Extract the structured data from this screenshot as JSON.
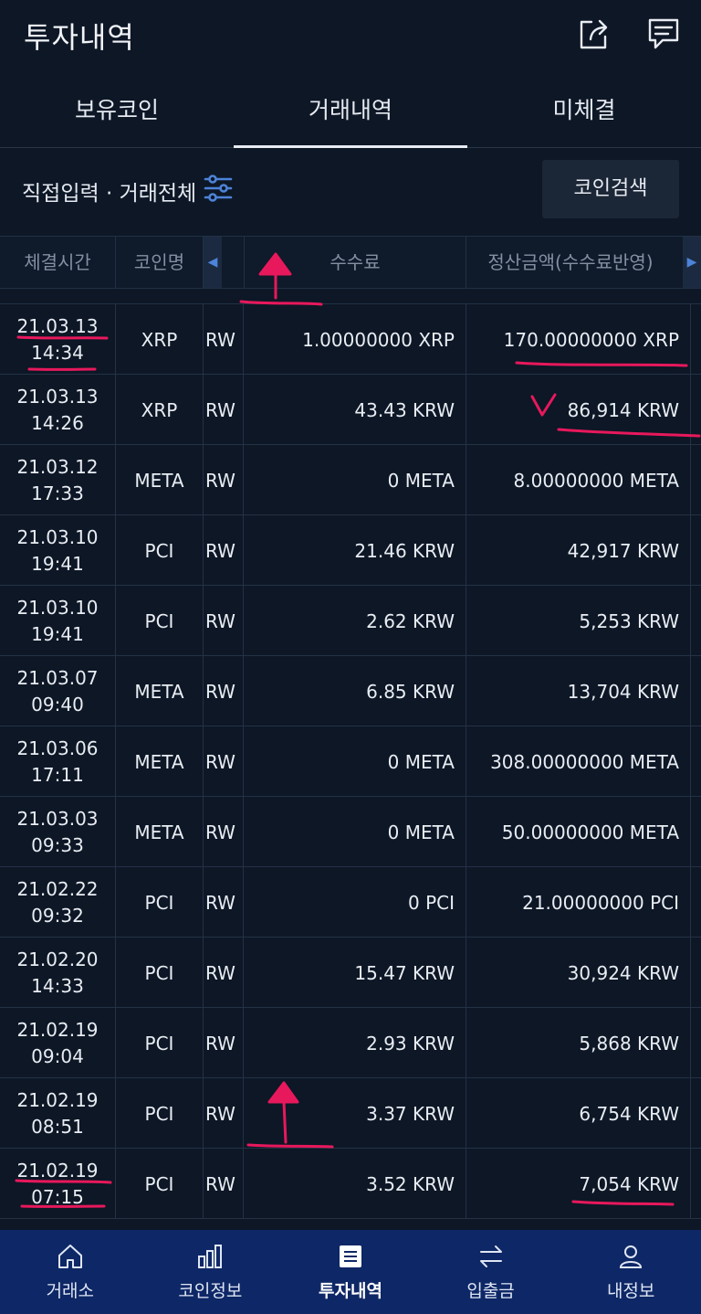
{
  "header": {
    "title": "투자내역",
    "icons": [
      "share-icon",
      "chat-icon"
    ]
  },
  "tabs": [
    {
      "label": "보유코인",
      "active": false
    },
    {
      "label": "거래내역",
      "active": true
    },
    {
      "label": "미체결",
      "active": false
    }
  ],
  "filter": {
    "label": "직접입력 · 거래전체",
    "search_button": "코인검색"
  },
  "table": {
    "headers": [
      "체결시간",
      "코인명",
      "수수료",
      "정산금액(수수료반영)"
    ],
    "rows": [
      {
        "date": "21.03.13",
        "time": "14:34",
        "coin": "XRP",
        "type": "RW",
        "fee": "1.00000000 XRP",
        "settle": "170.00000000 XRP"
      },
      {
        "date": "21.03.13",
        "time": "14:26",
        "coin": "XRP",
        "type": "RW",
        "fee": "43.43 KRW",
        "settle": "86,914 KRW"
      },
      {
        "date": "21.03.12",
        "time": "17:33",
        "coin": "META",
        "type": "RW",
        "fee": "0 META",
        "settle": "8.00000000 META"
      },
      {
        "date": "21.03.10",
        "time": "19:41",
        "coin": "PCI",
        "type": "RW",
        "fee": "21.46 KRW",
        "settle": "42,917 KRW"
      },
      {
        "date": "21.03.10",
        "time": "19:41",
        "coin": "PCI",
        "type": "RW",
        "fee": "2.62 KRW",
        "settle": "5,253 KRW"
      },
      {
        "date": "21.03.07",
        "time": "09:40",
        "coin": "META",
        "type": "RW",
        "fee": "6.85 KRW",
        "settle": "13,704 KRW"
      },
      {
        "date": "21.03.06",
        "time": "17:11",
        "coin": "META",
        "type": "RW",
        "fee": "0 META",
        "settle": "308.00000000 META"
      },
      {
        "date": "21.03.03",
        "time": "09:33",
        "coin": "META",
        "type": "RW",
        "fee": "0 META",
        "settle": "50.00000000 META"
      },
      {
        "date": "21.02.22",
        "time": "09:32",
        "coin": "PCI",
        "type": "RW",
        "fee": "0 PCI",
        "settle": "21.00000000 PCI"
      },
      {
        "date": "21.02.20",
        "time": "14:33",
        "coin": "PCI",
        "type": "RW",
        "fee": "15.47 KRW",
        "settle": "30,924 KRW"
      },
      {
        "date": "21.02.19",
        "time": "09:04",
        "coin": "PCI",
        "type": "RW",
        "fee": "2.93 KRW",
        "settle": "5,868 KRW"
      },
      {
        "date": "21.02.19",
        "time": "08:51",
        "coin": "PCI",
        "type": "RW",
        "fee": "3.37 KRW",
        "settle": "6,754 KRW"
      },
      {
        "date": "21.02.19",
        "time": "07:15",
        "coin": "PCI",
        "type": "RW",
        "fee": "3.52 KRW",
        "settle": "7,054 KRW"
      }
    ]
  },
  "bottom_nav": [
    {
      "label": "거래소",
      "icon": "home-icon",
      "active": false
    },
    {
      "label": "코인정보",
      "icon": "bar-chart-icon",
      "active": false
    },
    {
      "label": "투자내역",
      "icon": "document-icon",
      "active": true
    },
    {
      "label": "입출금",
      "icon": "transfer-icon",
      "active": false
    },
    {
      "label": "내정보",
      "icon": "user-icon",
      "active": false
    }
  ],
  "colors": {
    "background": "#0d1726",
    "nav_background": "#0e2766",
    "accent_blue": "#4d83d8",
    "annotation": "#e8185c"
  }
}
